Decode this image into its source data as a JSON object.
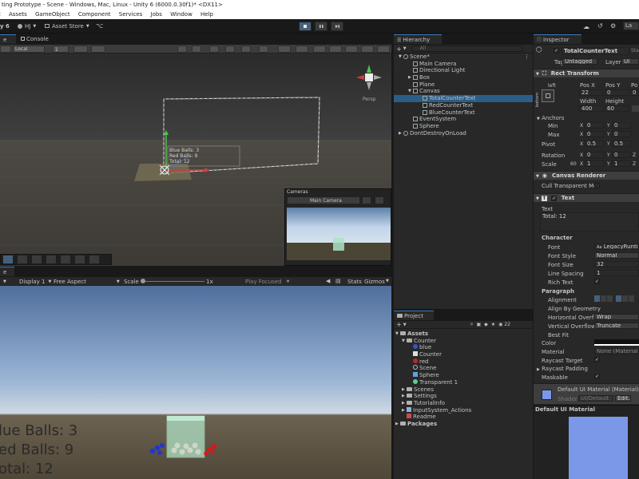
{
  "window": {
    "title": "ting Prototype - Scene - Windows, Mac, Linux - Unity 6 (6000.0.30f1)* <DX11>"
  },
  "menu": [
    "t",
    "Assets",
    "GameObject",
    "Component",
    "Services",
    "Jobs",
    "Window",
    "Help"
  ],
  "toolbar": {
    "unity_label": "y 6",
    "account": "HJ",
    "asset_store": "Asset Store",
    "layout": "La"
  },
  "scene_view": {
    "tabs": [
      "e",
      "Console"
    ],
    "local": "Local",
    "snap": "1",
    "persp": "Persp",
    "overlay_text": [
      "Blue Balls: 3",
      "Red Balls: 9",
      "Total: 12"
    ]
  },
  "camera_preview": {
    "title": "Cameras",
    "camera": "Main Camera"
  },
  "game_view": {
    "tab": "e",
    "display": "Display 1",
    "aspect": "Free Aspect",
    "scale_label": "Scale",
    "scale_value": "1x",
    "play_mode": "Play Focused",
    "stats": "Stats",
    "gizmos": "Gizmos",
    "texts": [
      "lue Balls: 3",
      "ed Balls: 9",
      "otal: 12"
    ]
  },
  "hierarchy": {
    "title": "Hierarchy",
    "search_placeholder": "All",
    "items": [
      {
        "label": "Scene*",
        "depth": 0
      },
      {
        "label": "Main Camera",
        "depth": 1
      },
      {
        "label": "Directional Light",
        "depth": 1
      },
      {
        "label": "Box",
        "depth": 1
      },
      {
        "label": "Plane",
        "depth": 1
      },
      {
        "label": "Canvas",
        "depth": 1
      },
      {
        "label": "TotalCounterText",
        "depth": 2
      },
      {
        "label": "RedCounterText",
        "depth": 2
      },
      {
        "label": "BlueCounterText",
        "depth": 2
      },
      {
        "label": "EventSystem",
        "depth": 1
      },
      {
        "label": "Sphere",
        "depth": 1
      },
      {
        "label": "DontDestroyOnLoad",
        "depth": 0
      }
    ]
  },
  "project": {
    "title": "Project",
    "count": "22",
    "items": [
      {
        "label": "Assets",
        "depth": 0,
        "kind": "folder"
      },
      {
        "label": "Counter",
        "depth": 1,
        "kind": "folder"
      },
      {
        "label": "blue",
        "depth": 2,
        "kind": "material"
      },
      {
        "label": "Counter",
        "depth": 2,
        "kind": "script"
      },
      {
        "label": "red",
        "depth": 2,
        "kind": "material"
      },
      {
        "label": "Scene",
        "depth": 2,
        "kind": "scene"
      },
      {
        "label": "Sphere",
        "depth": 2,
        "kind": "prefab"
      },
      {
        "label": "Transparent 1",
        "depth": 2,
        "kind": "material"
      },
      {
        "label": "Scenes",
        "depth": 1,
        "kind": "folder"
      },
      {
        "label": "Settings",
        "depth": 1,
        "kind": "folder"
      },
      {
        "label": "TutorialInfo",
        "depth": 1,
        "kind": "folder"
      },
      {
        "label": "InputSystem_Actions",
        "depth": 1,
        "kind": "asset"
      },
      {
        "label": "Readme",
        "depth": 1,
        "kind": "asset"
      },
      {
        "label": "Packages",
        "depth": 0,
        "kind": "folder"
      }
    ]
  },
  "inspector": {
    "title": "Inspector",
    "object_name": "TotalCounterText",
    "static": "Sta",
    "tag_label": "Tag",
    "tag": "Untagged",
    "layer_label": "Layer",
    "layer": "UI",
    "rect_transform": {
      "title": "Rect Transform",
      "anchor_label": "left",
      "anchor_side": "bottom",
      "pos_x_label": "Pos X",
      "pos_y_label": "Pos Y",
      "pos_z_label": "Po",
      "pos_x": "22",
      "pos_y": "0",
      "pos_z": "0",
      "width_label": "Width",
      "height_label": "Height",
      "width": "400",
      "height": "60",
      "anchors_label": "Anchors",
      "min_label": "Min",
      "max_label": "Max",
      "pivot_label": "Pivot",
      "min_x": "0",
      "min_y": "0",
      "max_x": "0",
      "max_y": "0",
      "pivot_x": "0.5",
      "pivot_y": "0.5",
      "rotation_label": "Rotation",
      "scale_label": "Scale",
      "rot_x": "0",
      "rot_y": "0",
      "rot_z": "Z",
      "scale_x": "1",
      "scale_y": "1",
      "scale_z": "Z",
      "scale_num": "60"
    },
    "canvas_renderer": {
      "title": "Canvas Renderer",
      "cull_label": "Cull Transparent Mes"
    },
    "text_component": {
      "title": "Text",
      "text_label": "Text",
      "text_value": "Total: 12",
      "character_label": "Character",
      "font_label": "Font",
      "font": "LegacyRuntime",
      "font_style_label": "Font Style",
      "font_style": "Normal",
      "font_size_label": "Font Size",
      "font_size": "32",
      "line_spacing_label": "Line Spacing",
      "line_spacing": "1",
      "rich_text_label": "Rich Text",
      "paragraph_label": "Paragraph",
      "alignment_label": "Alignment",
      "align_geometry_label": "Align By Geometry",
      "horiz_overflow_label": "Horizontal Overflo",
      "horiz_overflow": "Wrap",
      "vert_overflow_label": "Vertical Overflow",
      "vert_overflow": "Truncate",
      "best_fit_label": "Best Fit",
      "color_label": "Color",
      "material_label": "Material",
      "material": "None (Material)",
      "raycast_target_label": "Raycast Target",
      "raycast_padding_label": "Raycast Padding",
      "maskable_label": "Maskable"
    },
    "material_panel": {
      "name": "Default UI Material (Material)",
      "shader_label": "Shader",
      "shader": "UI/Default",
      "edit": "Edit..."
    },
    "preview_title": "Default UI Material",
    "colors": {
      "preview": "#7b98e8",
      "accent": "#3a79bb"
    }
  }
}
